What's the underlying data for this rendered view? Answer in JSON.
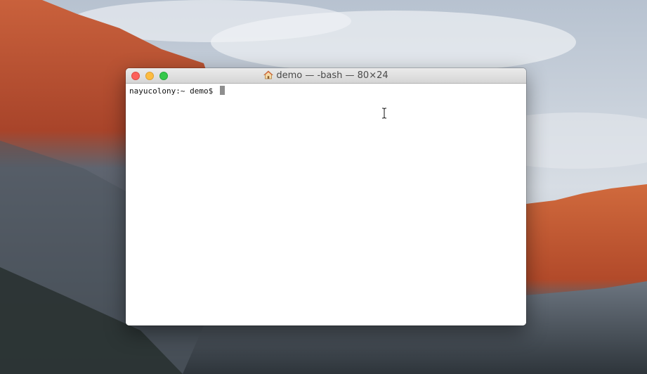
{
  "window": {
    "title": "demo — -bash — 80×24"
  },
  "terminal": {
    "prompt": "nayucolony:~ demo$ "
  },
  "icons": {
    "title_icon": "home-icon",
    "pointer": "ibeam-cursor-icon"
  },
  "colors": {
    "close": "#fc605b",
    "minimize": "#fdbc40",
    "zoom": "#34c84a",
    "cursor_block": "#8e8e8e"
  }
}
